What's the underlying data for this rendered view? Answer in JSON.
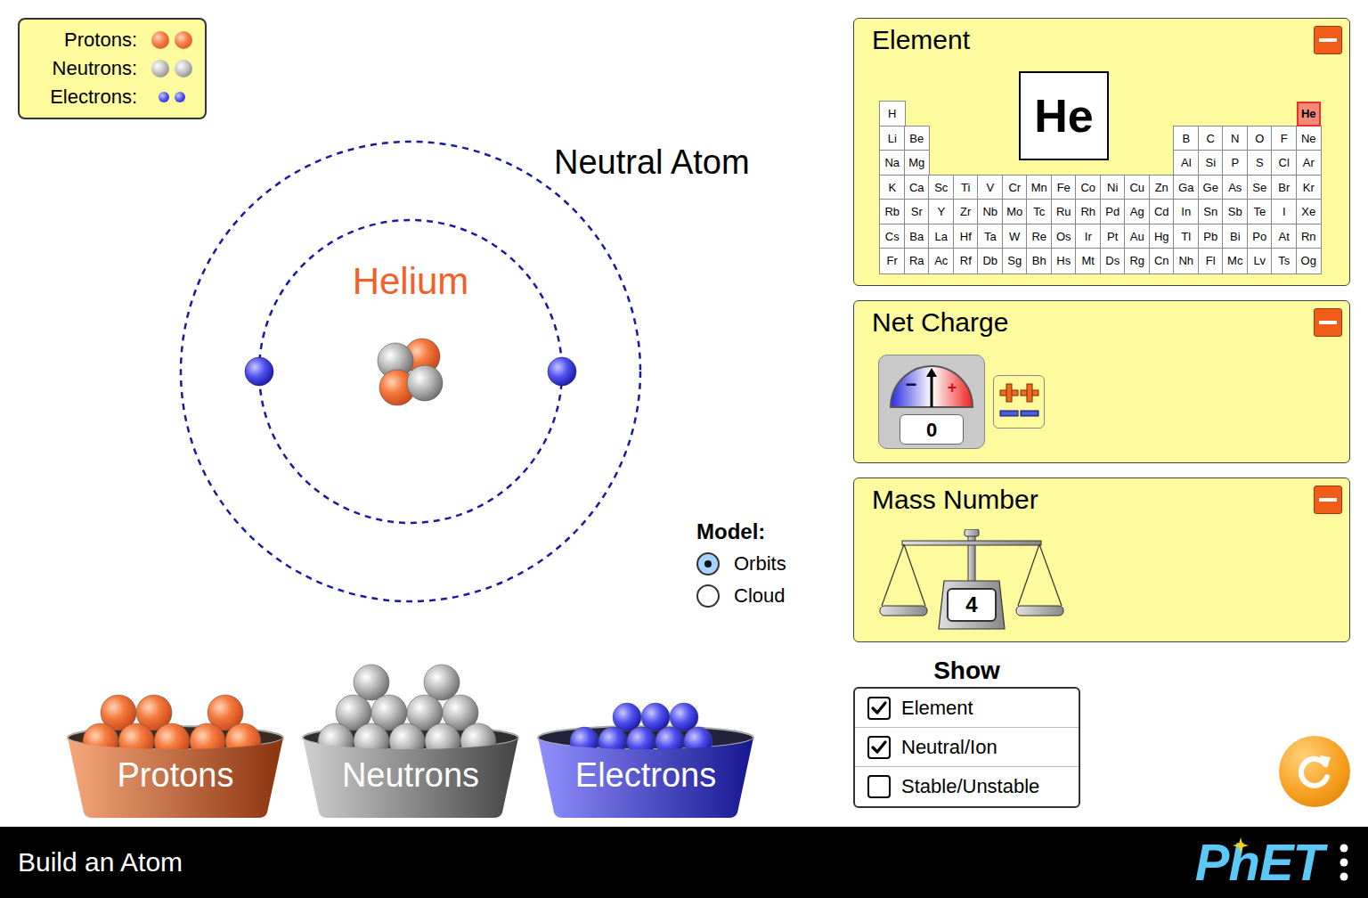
{
  "legend": [
    {
      "label": "Protons:",
      "kind": "proton"
    },
    {
      "label": "Neutrons:",
      "kind": "neutron"
    },
    {
      "label": "Electrons:",
      "kind": "electron"
    }
  ],
  "atom": {
    "name": "Helium",
    "status": "Neutral Atom",
    "protons": 2,
    "neutrons": 2,
    "electrons": 2
  },
  "model": {
    "title": "Model:",
    "options": [
      {
        "label": "Orbits",
        "selected": true
      },
      {
        "label": "Cloud",
        "selected": false
      }
    ]
  },
  "buckets": [
    {
      "label": "Protons",
      "kind": "proton"
    },
    {
      "label": "Neutrons",
      "kind": "neutron"
    },
    {
      "label": "Electrons",
      "kind": "electron"
    }
  ],
  "element_panel": {
    "title": "Element",
    "symbol": "He",
    "expanded": true,
    "periodic_table": [
      {
        "left": [
          {
            "symbol": "H",
            "selected": false
          }
        ],
        "right": [
          {
            "symbol": "He",
            "selected": true
          }
        ]
      },
      {
        "left": [
          {
            "symbol": "Li",
            "selected": false
          },
          {
            "symbol": "Be",
            "selected": false
          }
        ],
        "right": [
          {
            "symbol": "B",
            "selected": false
          },
          {
            "symbol": "C",
            "selected": false
          },
          {
            "symbol": "N",
            "selected": false
          },
          {
            "symbol": "O",
            "selected": false
          },
          {
            "symbol": "F",
            "selected": false
          },
          {
            "symbol": "Ne",
            "selected": false
          }
        ]
      },
      {
        "left": [
          {
            "symbol": "Na",
            "selected": false
          },
          {
            "symbol": "Mg",
            "selected": false
          }
        ],
        "right": [
          {
            "symbol": "Al",
            "selected": false
          },
          {
            "symbol": "Si",
            "selected": false
          },
          {
            "symbol": "P",
            "selected": false
          },
          {
            "symbol": "S",
            "selected": false
          },
          {
            "symbol": "Cl",
            "selected": false
          },
          {
            "symbol": "Ar",
            "selected": false
          }
        ]
      },
      {
        "left": [
          {
            "symbol": "K",
            "selected": false
          },
          {
            "symbol": "Ca",
            "selected": false
          },
          {
            "symbol": "Sc",
            "selected": false
          },
          {
            "symbol": "Ti",
            "selected": false
          },
          {
            "symbol": "V",
            "selected": false
          },
          {
            "symbol": "Cr",
            "selected": false
          },
          {
            "symbol": "Mn",
            "selected": false
          },
          {
            "symbol": "Fe",
            "selected": false
          },
          {
            "symbol": "Co",
            "selected": false
          },
          {
            "symbol": "Ni",
            "selected": false
          },
          {
            "symbol": "Cu",
            "selected": false
          },
          {
            "symbol": "Zn",
            "selected": false
          },
          {
            "symbol": "Ga",
            "selected": false
          },
          {
            "symbol": "Ge",
            "selected": false
          },
          {
            "symbol": "As",
            "selected": false
          },
          {
            "symbol": "Se",
            "selected": false
          },
          {
            "symbol": "Br",
            "selected": false
          },
          {
            "symbol": "Kr",
            "selected": false
          }
        ],
        "right": []
      },
      {
        "left": [
          {
            "symbol": "Rb",
            "selected": false
          },
          {
            "symbol": "Sr",
            "selected": false
          },
          {
            "symbol": "Y",
            "selected": false
          },
          {
            "symbol": "Zr",
            "selected": false
          },
          {
            "symbol": "Nb",
            "selected": false
          },
          {
            "symbol": "Mo",
            "selected": false
          },
          {
            "symbol": "Tc",
            "selected": false
          },
          {
            "symbol": "Ru",
            "selected": false
          },
          {
            "symbol": "Rh",
            "selected": false
          },
          {
            "symbol": "Pd",
            "selected": false
          },
          {
            "symbol": "Ag",
            "selected": false
          },
          {
            "symbol": "Cd",
            "selected": false
          },
          {
            "symbol": "In",
            "selected": false
          },
          {
            "symbol": "Sn",
            "selected": false
          },
          {
            "symbol": "Sb",
            "selected": false
          },
          {
            "symbol": "Te",
            "selected": false
          },
          {
            "symbol": "I",
            "selected": false
          },
          {
            "symbol": "Xe",
            "selected": false
          }
        ],
        "right": []
      },
      {
        "left": [
          {
            "symbol": "Cs",
            "selected": false
          },
          {
            "symbol": "Ba",
            "selected": false
          },
          {
            "symbol": "La",
            "selected": false
          },
          {
            "symbol": "Hf",
            "selected": false
          },
          {
            "symbol": "Ta",
            "selected": false
          },
          {
            "symbol": "W",
            "selected": false
          },
          {
            "symbol": "Re",
            "selected": false
          },
          {
            "symbol": "Os",
            "selected": false
          },
          {
            "symbol": "Ir",
            "selected": false
          },
          {
            "symbol": "Pt",
            "selected": false
          },
          {
            "symbol": "Au",
            "selected": false
          },
          {
            "symbol": "Hg",
            "selected": false
          },
          {
            "symbol": "Tl",
            "selected": false
          },
          {
            "symbol": "Pb",
            "selected": false
          },
          {
            "symbol": "Bi",
            "selected": false
          },
          {
            "symbol": "Po",
            "selected": false
          },
          {
            "symbol": "At",
            "selected": false
          },
          {
            "symbol": "Rn",
            "selected": false
          }
        ],
        "right": []
      },
      {
        "left": [
          {
            "symbol": "Fr",
            "selected": false
          },
          {
            "symbol": "Ra",
            "selected": false
          },
          {
            "symbol": "Ac",
            "selected": false
          },
          {
            "symbol": "Rf",
            "selected": false
          },
          {
            "symbol": "Db",
            "selected": false
          },
          {
            "symbol": "Sg",
            "selected": false
          },
          {
            "symbol": "Bh",
            "selected": false
          },
          {
            "symbol": "Hs",
            "selected": false
          },
          {
            "symbol": "Mt",
            "selected": false
          },
          {
            "symbol": "Ds",
            "selected": false
          },
          {
            "symbol": "Rg",
            "selected": false
          },
          {
            "symbol": "Cn",
            "selected": false
          },
          {
            "symbol": "Nh",
            "selected": false
          },
          {
            "symbol": "Fl",
            "selected": false
          },
          {
            "symbol": "Mc",
            "selected": false
          },
          {
            "symbol": "Lv",
            "selected": false
          },
          {
            "symbol": "Ts",
            "selected": false
          },
          {
            "symbol": "Og",
            "selected": false
          }
        ],
        "right": []
      }
    ]
  },
  "net_charge_panel": {
    "title": "Net Charge",
    "value": "0",
    "level": 0.5,
    "minus": "−",
    "plus": "+",
    "expanded": true
  },
  "mass_number_panel": {
    "title": "Mass Number",
    "value": "4",
    "expanded": true
  },
  "show": {
    "title": "Show",
    "options": [
      {
        "label": "Element",
        "checked": true
      },
      {
        "label": "Neutral/Ion",
        "checked": true
      },
      {
        "label": "Stable/Unstable",
        "checked": false
      }
    ]
  },
  "footer": {
    "title": "Build an Atom",
    "logo": "PhET"
  }
}
